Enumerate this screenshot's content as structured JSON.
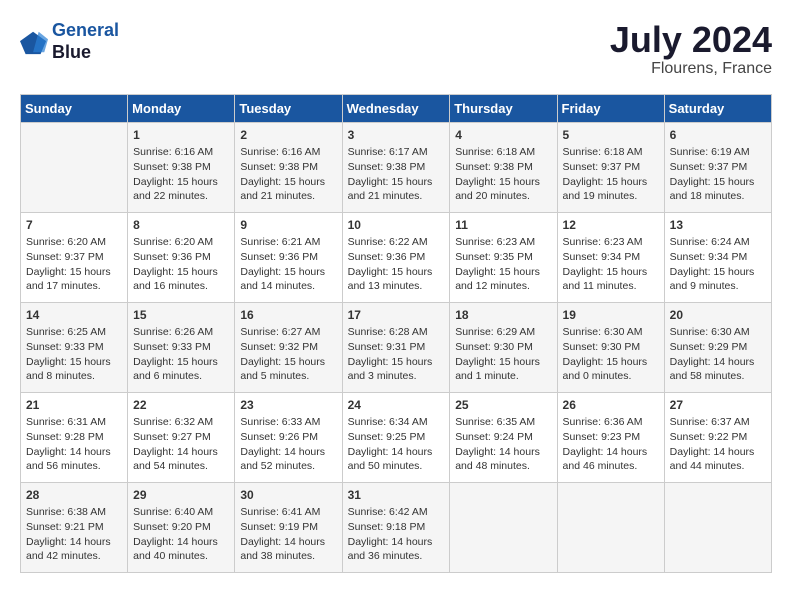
{
  "header": {
    "logo_line1": "General",
    "logo_line2": "Blue",
    "month_year": "July 2024",
    "location": "Flourens, France"
  },
  "days_of_week": [
    "Sunday",
    "Monday",
    "Tuesday",
    "Wednesday",
    "Thursday",
    "Friday",
    "Saturday"
  ],
  "weeks": [
    [
      {
        "day": "",
        "content": ""
      },
      {
        "day": "1",
        "content": "Sunrise: 6:16 AM\nSunset: 9:38 PM\nDaylight: 15 hours\nand 22 minutes."
      },
      {
        "day": "2",
        "content": "Sunrise: 6:16 AM\nSunset: 9:38 PM\nDaylight: 15 hours\nand 21 minutes."
      },
      {
        "day": "3",
        "content": "Sunrise: 6:17 AM\nSunset: 9:38 PM\nDaylight: 15 hours\nand 21 minutes."
      },
      {
        "day": "4",
        "content": "Sunrise: 6:18 AM\nSunset: 9:38 PM\nDaylight: 15 hours\nand 20 minutes."
      },
      {
        "day": "5",
        "content": "Sunrise: 6:18 AM\nSunset: 9:37 PM\nDaylight: 15 hours\nand 19 minutes."
      },
      {
        "day": "6",
        "content": "Sunrise: 6:19 AM\nSunset: 9:37 PM\nDaylight: 15 hours\nand 18 minutes."
      }
    ],
    [
      {
        "day": "7",
        "content": "Sunrise: 6:20 AM\nSunset: 9:37 PM\nDaylight: 15 hours\nand 17 minutes."
      },
      {
        "day": "8",
        "content": "Sunrise: 6:20 AM\nSunset: 9:36 PM\nDaylight: 15 hours\nand 16 minutes."
      },
      {
        "day": "9",
        "content": "Sunrise: 6:21 AM\nSunset: 9:36 PM\nDaylight: 15 hours\nand 14 minutes."
      },
      {
        "day": "10",
        "content": "Sunrise: 6:22 AM\nSunset: 9:36 PM\nDaylight: 15 hours\nand 13 minutes."
      },
      {
        "day": "11",
        "content": "Sunrise: 6:23 AM\nSunset: 9:35 PM\nDaylight: 15 hours\nand 12 minutes."
      },
      {
        "day": "12",
        "content": "Sunrise: 6:23 AM\nSunset: 9:34 PM\nDaylight: 15 hours\nand 11 minutes."
      },
      {
        "day": "13",
        "content": "Sunrise: 6:24 AM\nSunset: 9:34 PM\nDaylight: 15 hours\nand 9 minutes."
      }
    ],
    [
      {
        "day": "14",
        "content": "Sunrise: 6:25 AM\nSunset: 9:33 PM\nDaylight: 15 hours\nand 8 minutes."
      },
      {
        "day": "15",
        "content": "Sunrise: 6:26 AM\nSunset: 9:33 PM\nDaylight: 15 hours\nand 6 minutes."
      },
      {
        "day": "16",
        "content": "Sunrise: 6:27 AM\nSunset: 9:32 PM\nDaylight: 15 hours\nand 5 minutes."
      },
      {
        "day": "17",
        "content": "Sunrise: 6:28 AM\nSunset: 9:31 PM\nDaylight: 15 hours\nand 3 minutes."
      },
      {
        "day": "18",
        "content": "Sunrise: 6:29 AM\nSunset: 9:30 PM\nDaylight: 15 hours\nand 1 minute."
      },
      {
        "day": "19",
        "content": "Sunrise: 6:30 AM\nSunset: 9:30 PM\nDaylight: 15 hours\nand 0 minutes."
      },
      {
        "day": "20",
        "content": "Sunrise: 6:30 AM\nSunset: 9:29 PM\nDaylight: 14 hours\nand 58 minutes."
      }
    ],
    [
      {
        "day": "21",
        "content": "Sunrise: 6:31 AM\nSunset: 9:28 PM\nDaylight: 14 hours\nand 56 minutes."
      },
      {
        "day": "22",
        "content": "Sunrise: 6:32 AM\nSunset: 9:27 PM\nDaylight: 14 hours\nand 54 minutes."
      },
      {
        "day": "23",
        "content": "Sunrise: 6:33 AM\nSunset: 9:26 PM\nDaylight: 14 hours\nand 52 minutes."
      },
      {
        "day": "24",
        "content": "Sunrise: 6:34 AM\nSunset: 9:25 PM\nDaylight: 14 hours\nand 50 minutes."
      },
      {
        "day": "25",
        "content": "Sunrise: 6:35 AM\nSunset: 9:24 PM\nDaylight: 14 hours\nand 48 minutes."
      },
      {
        "day": "26",
        "content": "Sunrise: 6:36 AM\nSunset: 9:23 PM\nDaylight: 14 hours\nand 46 minutes."
      },
      {
        "day": "27",
        "content": "Sunrise: 6:37 AM\nSunset: 9:22 PM\nDaylight: 14 hours\nand 44 minutes."
      }
    ],
    [
      {
        "day": "28",
        "content": "Sunrise: 6:38 AM\nSunset: 9:21 PM\nDaylight: 14 hours\nand 42 minutes."
      },
      {
        "day": "29",
        "content": "Sunrise: 6:40 AM\nSunset: 9:20 PM\nDaylight: 14 hours\nand 40 minutes."
      },
      {
        "day": "30",
        "content": "Sunrise: 6:41 AM\nSunset: 9:19 PM\nDaylight: 14 hours\nand 38 minutes."
      },
      {
        "day": "31",
        "content": "Sunrise: 6:42 AM\nSunset: 9:18 PM\nDaylight: 14 hours\nand 36 minutes."
      },
      {
        "day": "",
        "content": ""
      },
      {
        "day": "",
        "content": ""
      },
      {
        "day": "",
        "content": ""
      }
    ]
  ]
}
